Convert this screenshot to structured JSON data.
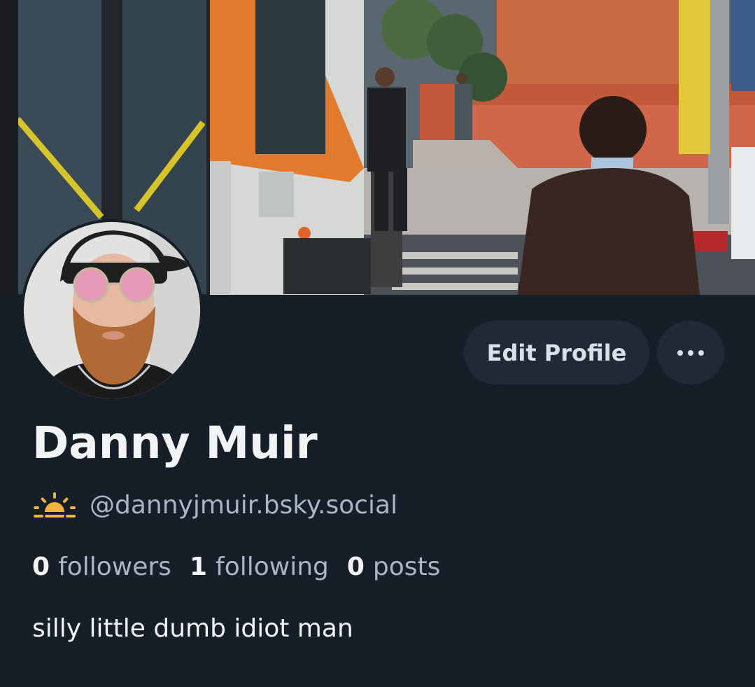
{
  "profile": {
    "display_name": "Danny Muir",
    "handle": "@dannyjmuir.bsky.social",
    "bio": "silly little dumb idiot man",
    "handle_icon": "sunrise-icon",
    "avatar_icon": "user-avatar-photo",
    "banner_icon": "street-bus-photo"
  },
  "actions": {
    "edit_label": "Edit Profile",
    "more_icon": "more-options-icon"
  },
  "stats": [
    {
      "value": "0",
      "label": "followers"
    },
    {
      "value": "1",
      "label": "following"
    },
    {
      "value": "0",
      "label": "posts"
    }
  ],
  "colors": {
    "background": "#161e27",
    "button_bg": "#1f2a36",
    "muted_text": "#a9b6c4",
    "accent_sun": "#f0b43c"
  }
}
